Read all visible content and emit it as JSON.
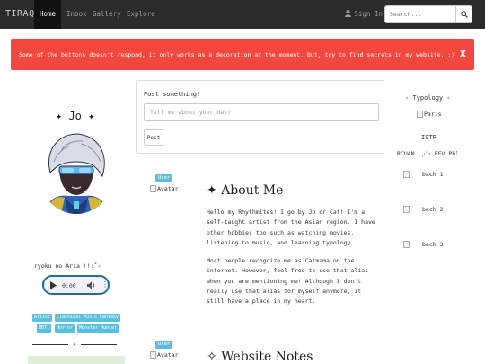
{
  "navbar": {
    "brand": "TIRAQS",
    "items": [
      {
        "label": "Home",
        "active": true
      },
      {
        "label": "Inbox",
        "active": false
      },
      {
        "label": "Gallery",
        "active": false
      },
      {
        "label": "Explore",
        "active": false
      }
    ],
    "signin_label": "Sign In",
    "search_placeholder": "Search..."
  },
  "alert": {
    "text": "Some of the buttons doesn't respond, it only works as a decoration at the moment. But, try to find secrets in my website. :)",
    "close": "x",
    "color": "#f2473d"
  },
  "profile": {
    "name": "✦ Jo ✦",
    "song_title": "ryoku no Aria !!:˚✧",
    "audio_time": "0:00",
    "tags": [
      "Artist",
      "Classical Music",
      "Fantasy",
      "MBTI",
      "Horror",
      "Monster Hunter"
    ],
    "divider_symbol": "✦"
  },
  "compose": {
    "title": "Post something!",
    "placeholder": "Tell me about your day!",
    "button": "Post"
  },
  "posts": [
    {
      "badge": "User",
      "avatar_alt": "Avatar",
      "heading": "✦ About Me",
      "paragraphs": [
        "Hello my Rhythmites! I go by Jo or Cat! I'm a self-taught artist from the Asian region. I have other hobbies too such as watching movies, listening to music, and learning typology.",
        "Most people recognize me as Catmama on the internet. However, feel free to use that alias when you are mentioning me! Although I don't really use that alias for myself anymore, it still have a place in my heart."
      ]
    },
    {
      "badge": "User",
      "avatar_alt": "Avatar",
      "heading": "✧ Website Notes"
    }
  ],
  "sidebar_right": {
    "typology_title": "✧ Typology ✧",
    "image_alt": "Paris",
    "type": "ISTP",
    "type_line": "RCUAN L⋰✧ EFV Phle",
    "bach_items": [
      "bach 1",
      "bach 2",
      "bach 3"
    ]
  },
  "colors": {
    "navbar": "#2b2b2b",
    "badge": "#5bc0de",
    "audio_border": "#1f6ba8"
  }
}
